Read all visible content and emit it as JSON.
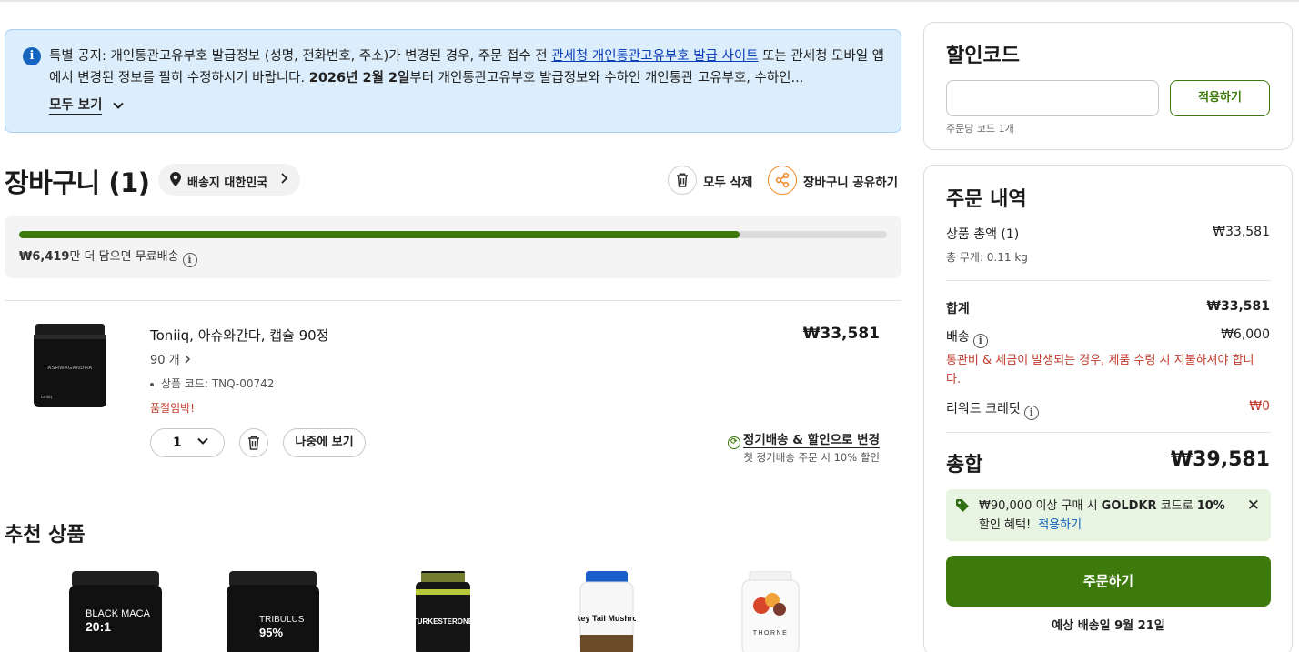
{
  "notice": {
    "text_before_link": "특별 공지: 개인통관고유부호 발급정보 (성명, 전화번호, 주소)가 변경된 경우, 주문 접수 전 ",
    "link_text": "관세청 개인통관고유부호 발급 사이트",
    "text_after_link": " 또는 관세청 모바일 앱에서 변경된 정보를 필히 수정하시기 바랍니다. ",
    "bold_date": "2026년 2월 2일",
    "text_tail": "부터 개인통관고유부호 발급정보와 수하인 개인통관 고유부호, 수하인...",
    "show_all": "모두 보기"
  },
  "cart": {
    "title": "장바구니 (1)",
    "ship_to": "배송지 대한민국",
    "delete_all": "모두 삭제",
    "share": "장바구니 공유하기",
    "progress": {
      "fraction": 0.83,
      "amount": "₩6,419",
      "text": "만 더 담으면 무료배송"
    }
  },
  "item": {
    "name": "Toniiq, 아슈와간다, 캡슐 90정",
    "count": "90 개",
    "code": "상품 코드: TNQ-00742",
    "stock": "품절임박!",
    "price": "₩33,581",
    "qty": "1",
    "later": "나중에 보기",
    "subscribe": "정기배송 & 할인으로 변경",
    "subscribe_note": "첫 정기배송 주문 시 10% 할인",
    "jar_label": "ASHWAGANDHA",
    "brand": "toniiq"
  },
  "recommend": {
    "title": "추천 상품",
    "items": [
      {
        "name": "BLACK MACA",
        "big": "20:1"
      },
      {
        "name": "TRIBULUS",
        "big": "95%"
      },
      {
        "name": "TURKESTERONE"
      },
      {
        "name": "Turkey Tail Mushroom"
      },
      {
        "name": "THORNE"
      }
    ]
  },
  "coupon": {
    "title": "할인코드",
    "input_value": "",
    "apply": "적용하기",
    "note": "주문당 코드 1개"
  },
  "summary": {
    "title": "주문 내역",
    "subtotal_label": "상품 총액 (1)",
    "subtotal": "₩33,581",
    "weight": "총 무게: 0.11 kg",
    "total_label": "합계",
    "total": "₩33,581",
    "shipping_label": "배송",
    "shipping": "₩6,000",
    "duty_note": "통관비 & 세금이 발생되는 경우, 제품 수령 시 지불하셔야 합니다.",
    "rewards_label": "리워드 크레딧",
    "rewards": "₩0",
    "grand_label": "총합",
    "grand": "₩39,581",
    "promo": {
      "pre": "₩90,000 이상 구매 시 ",
      "code": "GOLDKR",
      "mid": " 코드로 ",
      "pct": "10%",
      "post": " 할인 혜택!",
      "apply": "적용하기"
    },
    "checkout": "주문하기",
    "eta": "예상 배송일 9월 21일"
  },
  "colors": {
    "brand_green": "#3d7a0b",
    "notice_bg": "#dcedfb",
    "warning_red": "#c0392b",
    "link_blue": "#0b3fb8"
  }
}
